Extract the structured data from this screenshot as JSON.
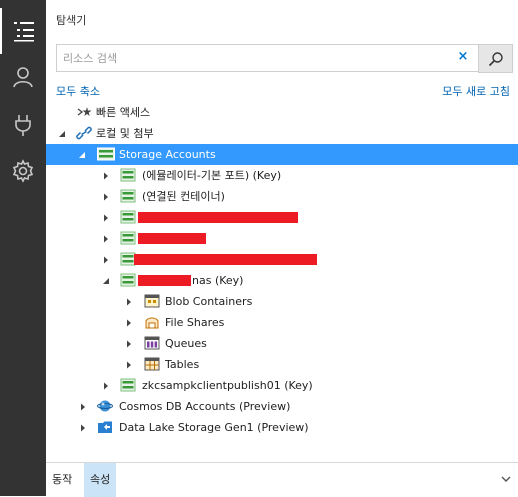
{
  "panel": {
    "title": "탐색기"
  },
  "search": {
    "placeholder": "리소스 검색",
    "clear_glyph": "×"
  },
  "links": {
    "collapse_all": "모두 축소",
    "refresh_all": "모두 새로 고침"
  },
  "tree": {
    "quick_access": "빠른 액세스",
    "local_attached": "로컬 및 첨부",
    "storage_accounts": "Storage Accounts",
    "emulator": "(에뮬레이터-기본 포트) (Key)",
    "attached_containers": "(연결된 컨테이너)",
    "account_nas": "nas (Key)",
    "blob_containers": "Blob Containers",
    "file_shares": "File Shares",
    "queues": "Queues",
    "tables": "Tables",
    "account_publish": "zkcsampkclientpublish01 (Key)",
    "cosmos": "Cosmos DB Accounts (Preview)",
    "datalake": "Data Lake Storage Gen1 (Preview)"
  },
  "tabs": {
    "actions": "동작",
    "properties": "속성"
  },
  "colors": {
    "selected": "#3399ff",
    "activity_bar": "#333333",
    "link": "#0063b1",
    "redaction": "#ed1c24"
  },
  "icons": [
    "list-icon",
    "account-icon",
    "plug-icon",
    "gear-icon",
    "search-icon",
    "storage-icon",
    "cosmos-icon",
    "datalake-icon",
    "link-icon",
    "quick-access-icon",
    "blob-icon",
    "file-share-icon",
    "queue-icon",
    "table-icon"
  ]
}
